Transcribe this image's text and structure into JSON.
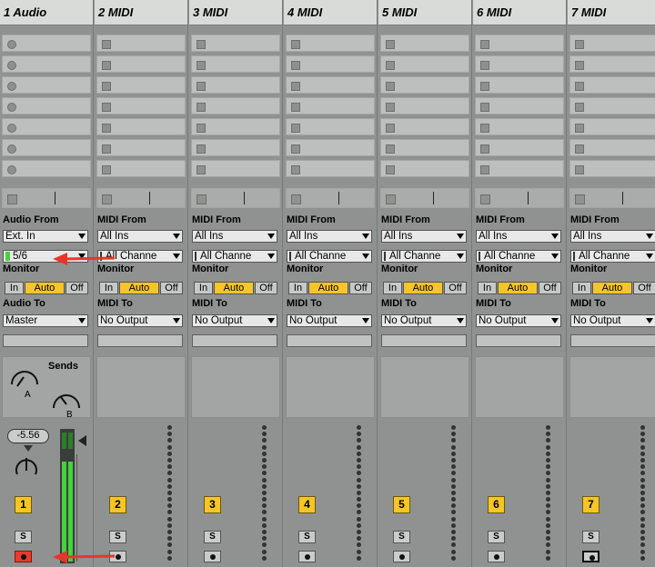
{
  "tracks": [
    {
      "name": "1 Audio",
      "num": "1",
      "type": "audio",
      "from_label": "Audio From",
      "from_value": "Ext. In",
      "channel_value": "5/6",
      "monitor_label": "Monitor",
      "monitor": [
        "In",
        "Auto",
        "Off"
      ],
      "to_label": "Audio To",
      "to_value": "Master",
      "sends_label": "Sends",
      "send_a": "A",
      "send_b": "B",
      "volume": "-5.56",
      "solo": "S",
      "arm_active": true
    },
    {
      "name": "2 MIDI",
      "num": "2",
      "type": "midi",
      "from_label": "MIDI From",
      "from_value": "All Ins",
      "channel_value": "All Channe",
      "monitor_label": "Monitor",
      "monitor": [
        "In",
        "Auto",
        "Off"
      ],
      "to_label": "MIDI To",
      "to_value": "No Output",
      "solo": "S",
      "arm_active": false
    },
    {
      "name": "3 MIDI",
      "num": "3",
      "type": "midi",
      "from_label": "MIDI From",
      "from_value": "All Ins",
      "channel_value": "All Channe",
      "monitor_label": "Monitor",
      "monitor": [
        "In",
        "Auto",
        "Off"
      ],
      "to_label": "MIDI To",
      "to_value": "No Output",
      "solo": "S",
      "arm_active": false
    },
    {
      "name": "4 MIDI",
      "num": "4",
      "type": "midi",
      "from_label": "MIDI From",
      "from_value": "All Ins",
      "channel_value": "All Channe",
      "monitor_label": "Monitor",
      "monitor": [
        "In",
        "Auto",
        "Off"
      ],
      "to_label": "MIDI To",
      "to_value": "No Output",
      "solo": "S",
      "arm_active": false
    },
    {
      "name": "5 MIDI",
      "num": "5",
      "type": "midi",
      "from_label": "MIDI From",
      "from_value": "All Ins",
      "channel_value": "All Channe",
      "monitor_label": "Monitor",
      "monitor": [
        "In",
        "Auto",
        "Off"
      ],
      "to_label": "MIDI To",
      "to_value": "No Output",
      "solo": "S",
      "arm_active": false
    },
    {
      "name": "6 MIDI",
      "num": "6",
      "type": "midi",
      "from_label": "MIDI From",
      "from_value": "All Ins",
      "channel_value": "All Channe",
      "monitor_label": "Monitor",
      "monitor": [
        "In",
        "Auto",
        "Off"
      ],
      "to_label": "MIDI To",
      "to_value": "No Output",
      "solo": "S",
      "arm_active": false
    },
    {
      "name": "7 MIDI",
      "num": "7",
      "type": "midi",
      "from_label": "MIDI From",
      "from_value": "All Ins",
      "channel_value": "All Channe",
      "monitor_label": "Monitor",
      "monitor": [
        "In",
        "Auto",
        "Off"
      ],
      "to_label": "MIDI To",
      "to_value": "No Output",
      "solo": "S",
      "arm_active": false
    }
  ],
  "clip_slot_rows": 7,
  "colors": {
    "accent_yellow": "#f7c525",
    "arm_red": "#e8392b",
    "annotation_arrow": "#e8352a",
    "meter_green": "#45d23c"
  },
  "annotations": [
    "red-arrow-to-input-channel",
    "red-arrow-to-arm-button"
  ]
}
